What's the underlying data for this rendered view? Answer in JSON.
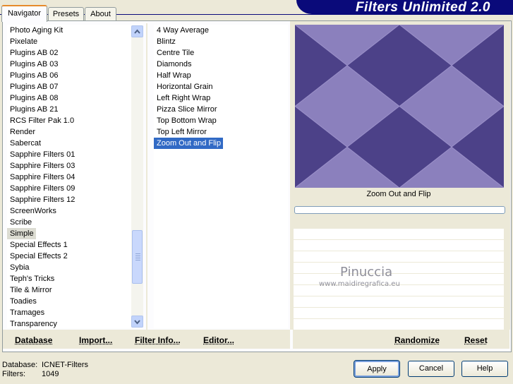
{
  "banner": {
    "title": "Filters Unlimited 2.0"
  },
  "tabs": [
    {
      "label": "Navigator"
    },
    {
      "label": "Presets"
    },
    {
      "label": "About"
    }
  ],
  "categories": {
    "items": [
      "Photo Aging Kit",
      "Pixelate",
      "Plugins AB 02",
      "Plugins AB 03",
      "Plugins AB 06",
      "Plugins AB 07",
      "Plugins AB 08",
      "Plugins AB 21",
      "RCS Filter Pak 1.0",
      "Render",
      "Sabercat",
      "Sapphire Filters 01",
      "Sapphire Filters 03",
      "Sapphire Filters 04",
      "Sapphire Filters 09",
      "Sapphire Filters 12",
      "ScreenWorks",
      "Scribe",
      "Simple",
      "Special Effects 1",
      "Special Effects 2",
      "Sybia",
      "Teph's Tricks",
      "Tile & Mirror",
      "Toadies",
      "Tramages",
      "Transparency"
    ],
    "selected": "Simple"
  },
  "filters": {
    "items": [
      "4 Way Average",
      "Blintz",
      "Centre Tile",
      "Diamonds",
      "Half Wrap",
      "Horizontal Grain",
      "Left Right Wrap",
      "Pizza Slice Mirror",
      "Top Bottom Wrap",
      "Top Left Mirror",
      "Zoom Out and Flip"
    ],
    "selected": "Zoom Out and Flip"
  },
  "preview": {
    "caption": "Zoom Out and Flip",
    "watermark": "Pinuccia",
    "watermark_url": "www.maidiregrafica.eu",
    "colors": {
      "light": "#9a8fc4",
      "dark": "#4a3f84"
    }
  },
  "bottom_links": {
    "database": "Database",
    "import": "Import...",
    "filter_info": "Filter Info...",
    "editor": "Editor...",
    "randomize": "Randomize",
    "reset": "Reset"
  },
  "status": {
    "database_label": "Database:",
    "database_value": "ICNET-Filters",
    "filters_label": "Filters:",
    "filters_value": "1049"
  },
  "buttons": {
    "apply": "Apply",
    "cancel": "Cancel",
    "help": "Help"
  }
}
